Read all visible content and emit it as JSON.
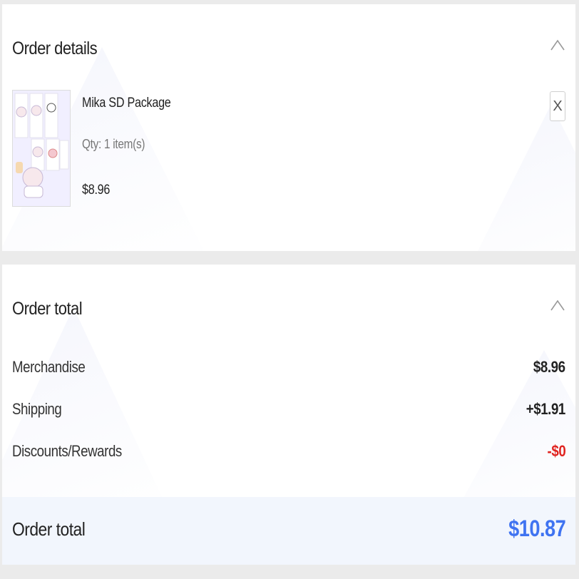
{
  "colors": {
    "accent": "#3f73f1",
    "discount": "#e0231f",
    "summary_bg": "#f2f6fd",
    "page_bg": "#ebebeb"
  },
  "order_details": {
    "title": "Order details",
    "collapse_icon": "chevron-up-icon",
    "item": {
      "name": "Mika SD Package",
      "qty": "Qty: 1 item(s)",
      "price": "$8.96",
      "remove_label": "X",
      "image": "mika-sd-package-thumbnail"
    }
  },
  "order_total": {
    "title": "Order total",
    "collapse_icon": "chevron-up-icon",
    "rows": [
      {
        "label": "Merchandise",
        "value": "$8.96"
      },
      {
        "label": "Shipping",
        "value": "+$1.91"
      },
      {
        "label": "Discounts/Rewards",
        "value": "-$0"
      }
    ],
    "summary": {
      "label": "Order total",
      "value": "$10.87"
    }
  }
}
